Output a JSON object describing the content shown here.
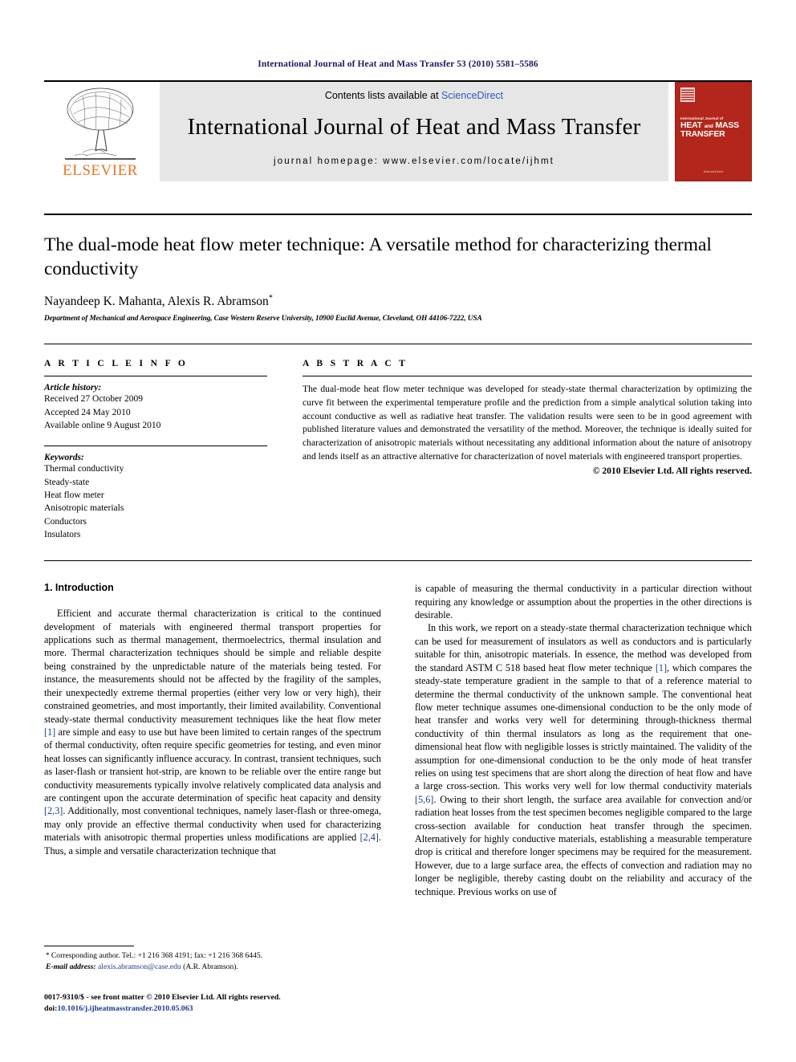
{
  "running_head": "International Journal of Heat and Mass Transfer 53 (2010) 5581–5586",
  "masthead": {
    "publisher_name": "ELSEVIER",
    "contents_prefix": "Contents lists available at ",
    "contents_link": "ScienceDirect",
    "journal_title": "International Journal of Heat and Mass Transfer",
    "homepage": "journal homepage: www.elsevier.com/locate/ijhmt",
    "cover": {
      "sub": "International Journal of",
      "line1": "HEAT",
      "line1_small": "and",
      "line1b": "MASS",
      "line2": "TRANSFER",
      "foot": "ScienceDirect"
    }
  },
  "article": {
    "title": "The dual-mode heat flow meter technique: A versatile method for characterizing thermal conductivity",
    "authors": "Nayandeep K. Mahanta, Alexis R. Abramson",
    "author_marker": "*",
    "affiliation": "Department of Mechanical and Aerospace Engineering, Case Western Reserve University, 10900 Euclid Avenue, Cleveland, OH 44106-7222, USA"
  },
  "info": {
    "heading": "A R T I C L E    I N F O",
    "history_label": "Article history:",
    "history": [
      "Received 27 October 2009",
      "Accepted 24 May 2010",
      "Available online 9 August 2010"
    ],
    "keywords_label": "Keywords:",
    "keywords": [
      "Thermal conductivity",
      "Steady-state",
      "Heat flow meter",
      "Anisotropic materials",
      "Conductors",
      "Insulators"
    ]
  },
  "abstract": {
    "heading": "A B S T R A C T",
    "text": "The dual-mode heat flow meter technique was developed for steady-state thermal characterization by optimizing the curve fit between the experimental temperature profile and the prediction from a simple analytical solution taking into account conductive as well as radiative heat transfer. The validation results were seen to be in good agreement with published literature values and demonstrated the versatility of the method. Moreover, the technique is ideally suited for characterization of anisotropic materials without necessitating any additional information about the nature of anisotropy and lends itself as an attractive alternative for characterization of novel materials with engineered transport properties.",
    "copyright": "© 2010 Elsevier Ltd. All rights reserved."
  },
  "body": {
    "section_heading": "1. Introduction",
    "left_para_1a": "Efficient and accurate thermal characterization is critical to the continued development of materials with engineered thermal transport properties for applications such as thermal management, thermoelectrics, thermal insulation and more. Thermal characterization techniques should be simple and reliable despite being constrained by the unpredictable nature of the materials being tested. For instance, the measurements should not be affected by the fragility of the samples, their unexpectedly extreme thermal properties (either very low or very high), their constrained geometries, and most importantly, their limited availability. Conventional steady-state thermal conductivity measurement techniques like the heat flow meter ",
    "cite_1": "[1]",
    "left_para_1b": " are simple and easy to use but have been limited to certain ranges of the spectrum of thermal conductivity, often require specific geometries for testing, and even minor heat losses can significantly influence accuracy. In contrast, transient techniques, such as laser-flash or transient hot-strip, are known to be reliable over the entire range but conductivity measurements typically involve relatively complicated data analysis and are contingent upon the accurate determination of specific heat capacity and density ",
    "cite_23": "[2,3]",
    "left_para_1c": ". Additionally, most conventional techniques, namely laser-flash or three-omega, may only provide an effective thermal conductivity when used for characterizing materials with anisotropic thermal properties unless modifications are applied ",
    "cite_24": "[2,4]",
    "left_para_1d": ". Thus, a simple and versatile characterization technique that",
    "right_para_1": "is capable of measuring the thermal conductivity in a particular direction without requiring any knowledge or assumption about the properties in the other directions is desirable.",
    "right_para_2a": "In this work, we report on a steady-state thermal characterization technique which can be used for measurement of insulators as well as conductors and is particularly suitable for thin, anisotropic materials. In essence, the method was developed from the standard ASTM C 518 based heat flow meter technique ",
    "cite_r1": "[1]",
    "right_para_2b": ", which compares the steady-state temperature gradient in the sample to that of a reference material to determine the thermal conductivity of the unknown sample. The conventional heat flow meter technique assumes one-dimensional conduction to be the only mode of heat transfer and works very well for determining through-thickness thermal conductivity of thin thermal insulators as long as the requirement that one-dimensional heat flow with negligible losses is strictly maintained. The validity of the assumption for one-dimensional conduction to be the only mode of heat transfer relies on using test specimens that are short along the direction of heat flow and have a large cross-section. This works very well for low thermal conductivity materials ",
    "cite_r56": "[5,6]",
    "right_para_2c": ". Owing to their short length, the surface area available for convection and/or radiation heat losses from the test specimen becomes negligible compared to the large cross-section available for conduction heat transfer through the specimen. Alternatively for highly conductive materials, establishing a measurable temperature drop is critical and therefore longer specimens may be required for the measurement. However, due to a large surface area, the effects of convection and radiation may no longer be negligible, thereby casting doubt on the reliability and accuracy of the technique. Previous works on use of"
  },
  "footnote": {
    "marker": "*",
    "corresponding": "Corresponding author. Tel.: +1 216 368 4191; fax: +1 216 368 6445.",
    "email_label": "E-mail address:",
    "email": "alexis.abramson@case.edu",
    "email_owner": "(A.R. Abramson)."
  },
  "footer": {
    "issn_line": "0017-9310/$ - see front matter © 2010 Elsevier Ltd. All rights reserved.",
    "doi_label": "doi:",
    "doi": "10.1016/j.ijheatmasstransfer.2010.05.063"
  }
}
